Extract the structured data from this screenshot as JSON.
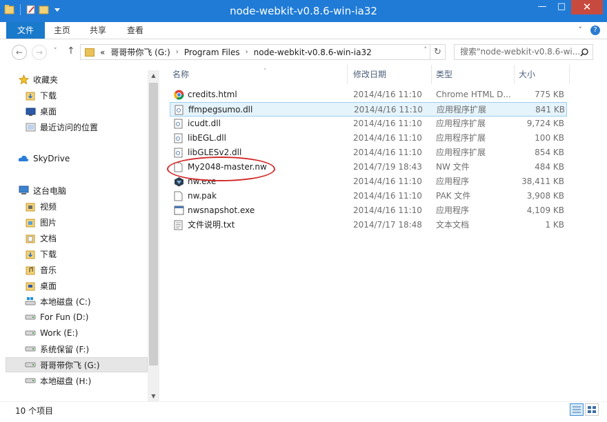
{
  "window": {
    "title": "node-webkit-v0.8.6-win-ia32"
  },
  "titlebar_buttons": {
    "minimize": "—",
    "maximize": "□",
    "close": "✕"
  },
  "ribbon": {
    "tabs": [
      {
        "label": "文件"
      },
      {
        "label": "主页"
      },
      {
        "label": "共享"
      },
      {
        "label": "查看"
      }
    ],
    "expand_icon": "˅",
    "help_icon": "?"
  },
  "nav": {
    "back": "←",
    "forward": "→",
    "up": "↑",
    "history": "˅"
  },
  "address": {
    "overflow": "«",
    "crumbs": [
      "哥哥带你飞 (G:)",
      "Program Files",
      "node-webkit-v0.8.6-win-ia32"
    ],
    "separator": "›",
    "refresh": "↻"
  },
  "search": {
    "placeholder": "搜索\"node-webkit-v0.8.6-wi...",
    "icon": "⌕"
  },
  "sidebar": {
    "items": [
      {
        "label": "收藏夹",
        "icon": "star-icon"
      },
      {
        "label": "下载",
        "icon": "downloads-folder-icon"
      },
      {
        "label": "桌面",
        "icon": "desktop-icon"
      },
      {
        "label": "最近访问的位置",
        "icon": "recent-places-icon"
      },
      {
        "label": "SkyDrive",
        "icon": "skydrive-icon"
      },
      {
        "label": "这台电脑",
        "icon": "this-pc-icon"
      },
      {
        "label": "视频",
        "icon": "videos-folder-icon"
      },
      {
        "label": "图片",
        "icon": "pictures-folder-icon"
      },
      {
        "label": "文档",
        "icon": "documents-folder-icon"
      },
      {
        "label": "下载",
        "icon": "downloads-folder-icon"
      },
      {
        "label": "音乐",
        "icon": "music-folder-icon"
      },
      {
        "label": "桌面",
        "icon": "desktop-folder-icon"
      },
      {
        "label": "本地磁盘 (C:)",
        "icon": "system-drive-icon"
      },
      {
        "label": "For Fun (D:)",
        "icon": "drive-icon"
      },
      {
        "label": "Work (E:)",
        "icon": "drive-icon"
      },
      {
        "label": "系统保留 (F:)",
        "icon": "drive-icon"
      },
      {
        "label": "哥哥带你飞 (G:)",
        "icon": "drive-icon",
        "selected": true
      },
      {
        "label": "本地磁盘 (H:)",
        "icon": "drive-icon"
      }
    ]
  },
  "columns": {
    "name": "名称",
    "date": "修改日期",
    "type": "类型",
    "size": "大小",
    "sort_indicator": "˄"
  },
  "files": [
    {
      "name": "credits.html",
      "date": "2014/4/16 11:10",
      "type": "Chrome HTML D...",
      "size": "775 KB",
      "icon": "chrome-html-icon"
    },
    {
      "name": "ffmpegsumo.dll",
      "date": "2014/4/16 11:10",
      "type": "应用程序扩展",
      "size": "841 KB",
      "icon": "dll-icon"
    },
    {
      "name": "icudt.dll",
      "date": "2014/4/16 11:10",
      "type": "应用程序扩展",
      "size": "9,724 KB",
      "icon": "dll-icon"
    },
    {
      "name": "libEGL.dll",
      "date": "2014/4/16 11:10",
      "type": "应用程序扩展",
      "size": "100 KB",
      "icon": "dll-icon"
    },
    {
      "name": "libGLESv2.dll",
      "date": "2014/4/16 11:10",
      "type": "应用程序扩展",
      "size": "854 KB",
      "icon": "dll-icon"
    },
    {
      "name": "My2048-master.nw",
      "date": "2014/7/19 18:43",
      "type": "NW 文件",
      "size": "484 KB",
      "icon": "blank-file-icon"
    },
    {
      "name": "nw.exe",
      "date": "2014/4/16 11:10",
      "type": "应用程序",
      "size": "38,411 KB",
      "icon": "nw-exe-icon"
    },
    {
      "name": "nw.pak",
      "date": "2014/4/16 11:10",
      "type": "PAK 文件",
      "size": "3,908 KB",
      "icon": "blank-file-icon"
    },
    {
      "name": "nwsnapshot.exe",
      "date": "2014/4/16 11:10",
      "type": "应用程序",
      "size": "4,109 KB",
      "icon": "exe-window-icon"
    },
    {
      "name": "文件说明.txt",
      "date": "2014/7/17 18:48",
      "type": "文本文档",
      "size": "1 KB",
      "icon": "text-file-icon"
    }
  ],
  "status": {
    "item_count": "10 个项目"
  },
  "colors": {
    "titlebar": "#1f7bd6",
    "file_tab": "#1979ca",
    "annotation": "#d22a2a",
    "row_highlight": "#e5f3fb"
  }
}
